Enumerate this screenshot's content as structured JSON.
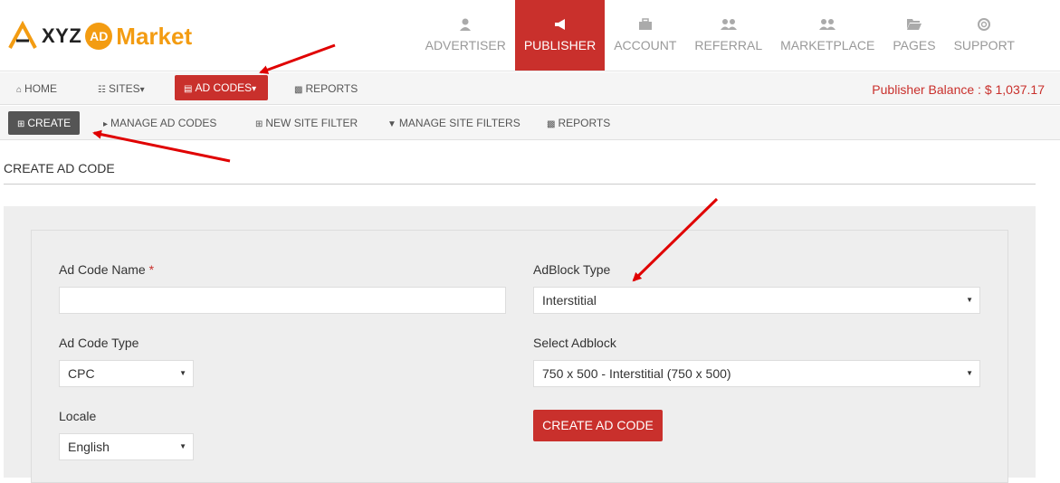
{
  "brand": {
    "logo_xyz": "XYZ",
    "logo_ad": "AD",
    "logo_market": "Market"
  },
  "main_nav": [
    {
      "label": "ADVERTISER",
      "icon": "user-icon"
    },
    {
      "label": "PUBLISHER",
      "icon": "bullhorn-icon",
      "active": true
    },
    {
      "label": "ACCOUNT",
      "icon": "briefcase-icon"
    },
    {
      "label": "REFERRAL",
      "icon": "users-icon"
    },
    {
      "label": "MARKETPLACE",
      "icon": "users-icon"
    },
    {
      "label": "PAGES",
      "icon": "folder-open-icon"
    },
    {
      "label": "SUPPORT",
      "icon": "life-ring-icon"
    }
  ],
  "sub_nav": {
    "home": "HOME",
    "sites": "SITES",
    "ad_codes": "AD CODES",
    "reports": "REPORTS",
    "balance": "Publisher Balance : $ 1,037.17"
  },
  "sub_nav2": {
    "create": "CREATE",
    "manage_ad_codes": "MANAGE AD CODES",
    "new_site_filter": "NEW SITE FILTER",
    "manage_site_filters": "MANAGE SITE FILTERS",
    "reports": "REPORTS"
  },
  "page": {
    "title": "CREATE AD CODE"
  },
  "form": {
    "ad_code_name_label": "Ad Code Name",
    "required_mark": "*",
    "ad_code_name_value": "",
    "ad_code_type_label": "Ad Code Type",
    "ad_code_type_value": "CPC",
    "locale_label": "Locale",
    "locale_value": "English",
    "adblock_type_label": "AdBlock Type",
    "adblock_type_value": "Interstitial",
    "select_adblock_label": "Select Adblock",
    "select_adblock_value": "750 x 500 - Interstitial (750 x 500)",
    "submit_label": "CREATE AD CODE"
  },
  "colors": {
    "accent": "#c9302c",
    "logo_orange": "#f39c12"
  }
}
